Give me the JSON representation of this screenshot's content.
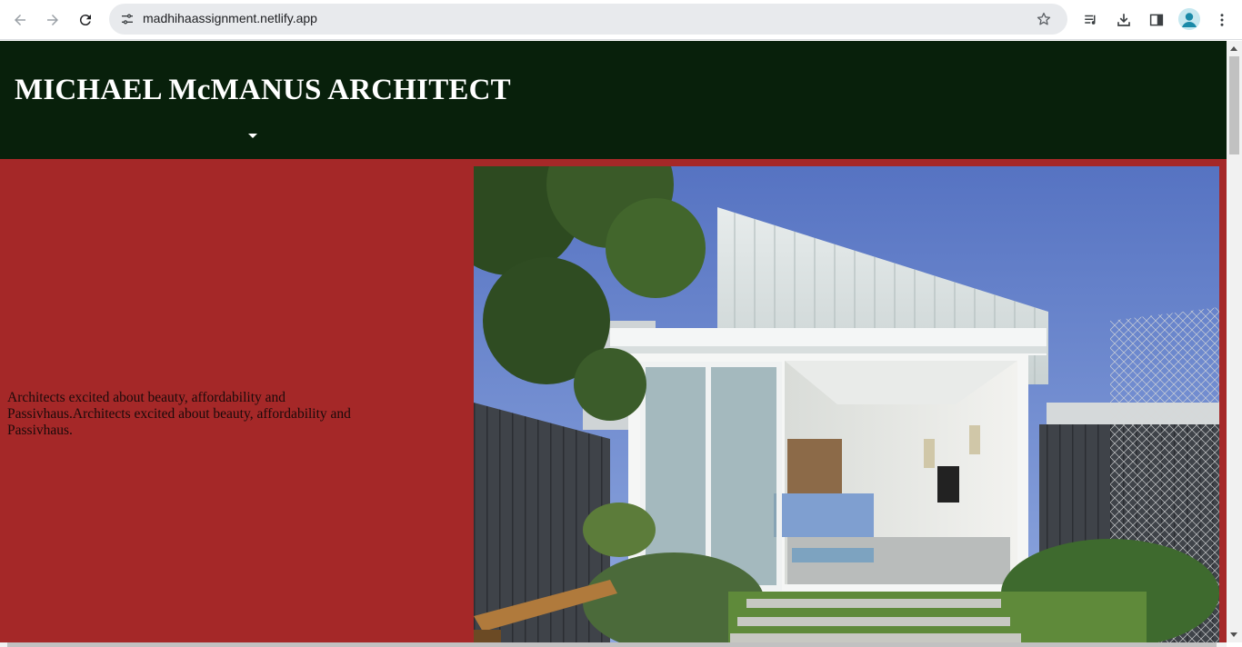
{
  "browser": {
    "url": "madhihaassignment.netlify.app",
    "icons": {
      "back": "arrow-left-icon",
      "forward": "arrow-right-icon",
      "reload": "reload-icon",
      "site_info": "tune-icon",
      "bookmark": "star-icon",
      "media": "media-controls-icon",
      "download": "download-icon",
      "side_panel": "side-panel-icon",
      "profile": "profile-avatar-icon",
      "menu": "kebab-menu-icon"
    }
  },
  "site": {
    "title": "MICHAEL McMANUS ARCHITECT",
    "tagline": "Architects excited about beauty, affordability and Passivhaus.Architects excited about beauty, affordability and Passivhaus.",
    "colors": {
      "header_bg": "#08200b",
      "body_bg": "#a52828",
      "title_color": "#ffffff"
    }
  }
}
